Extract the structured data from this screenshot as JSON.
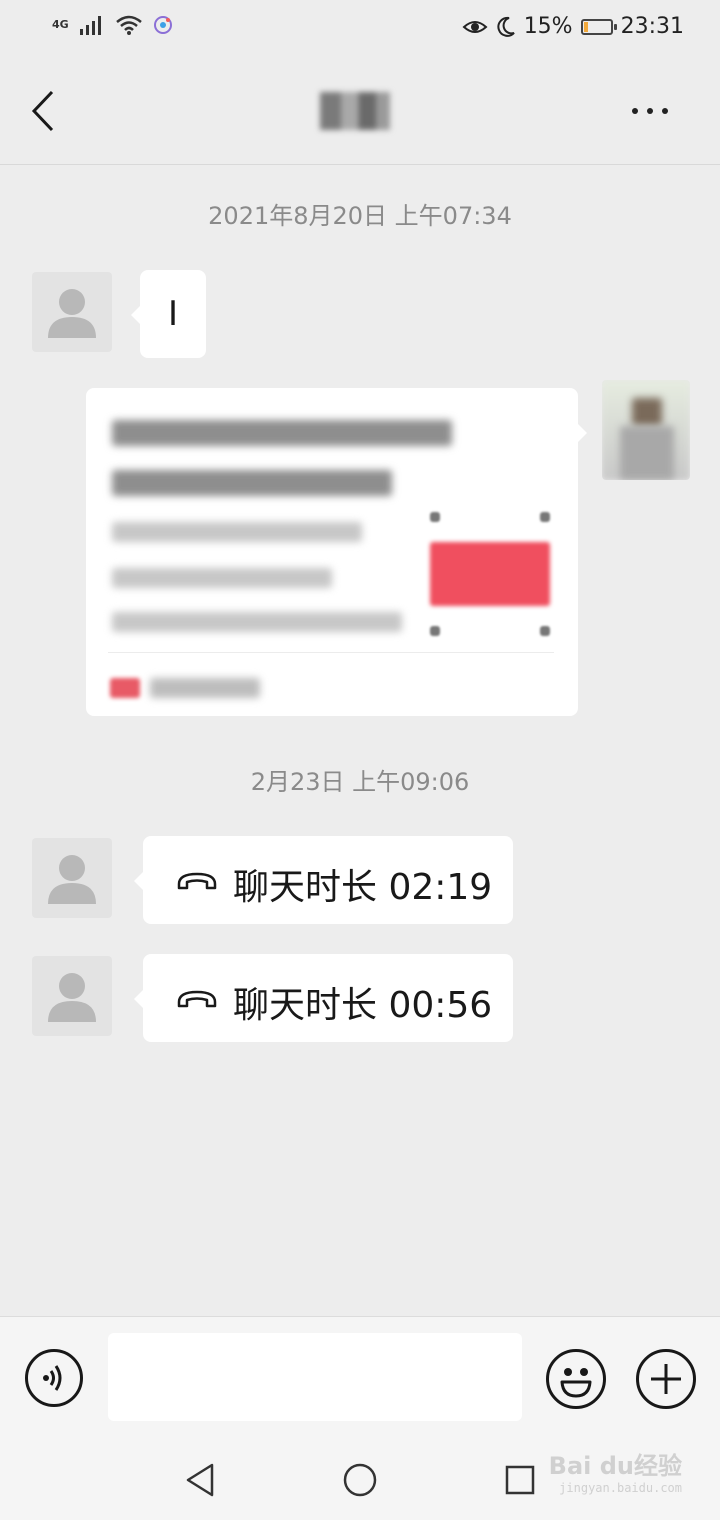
{
  "status_bar": {
    "network": "4G",
    "battery_percent": "15%",
    "battery_level": 0.15,
    "time": "23:31",
    "icons": [
      "signal-icon",
      "wifi-icon",
      "app-notification-icon",
      "eye-icon",
      "moon-icon",
      "battery-icon"
    ]
  },
  "header": {
    "back_icon": "back-arrow-icon",
    "more_icon": "more-dots-icon"
  },
  "messages": {
    "timestamp_1": "2021年8月20日 上午07:34",
    "msg_1_text": "I",
    "timestamp_2": "2月23日 上午09:06",
    "call_1": "聊天时长 02:19",
    "call_2": "聊天时长 00:56"
  },
  "input_bar": {
    "voice_icon": "voice-icon",
    "emoji_icon": "emoji-icon",
    "plus_icon": "plus-icon"
  },
  "nav_bar": {
    "icons": [
      "nav-back-icon",
      "nav-home-icon",
      "nav-recents-icon"
    ]
  },
  "watermark": {
    "logo": "Bai du经验",
    "url": "jingyan.baidu.com"
  },
  "colors": {
    "background": "#ededed",
    "bubble": "#ffffff",
    "battery_fill": "#f2a93b"
  }
}
